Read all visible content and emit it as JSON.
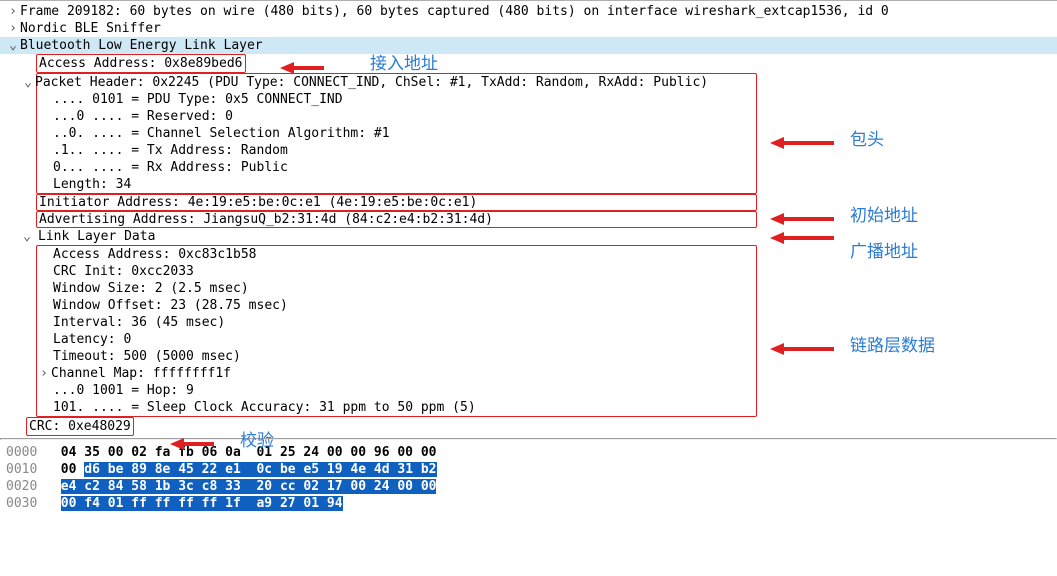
{
  "tree": {
    "frame": "Frame 209182: 60 bytes on wire (480 bits), 60 bytes captured (480 bits) on interface wireshark_extcap1536, id 0",
    "nordic": "Nordic BLE Sniffer",
    "ble_ll": "Bluetooth Low Energy Link Layer",
    "access_addr": "Access Address: 0x8e89bed6",
    "pkt_header": "Packet Header: 0x2245 (PDU Type: CONNECT_IND, ChSel: #1, TxAdd: Random, RxAdd: Public)",
    "pdu_type": ".... 0101 = PDU Type: 0x5 CONNECT_IND",
    "reserved": "...0 .... = Reserved: 0",
    "chsel": "..0. .... = Channel Selection Algorithm: #1",
    "txaddr": ".1.. .... = Tx Address: Random",
    "rxaddr": "0... .... = Rx Address: Public",
    "length": "Length: 34",
    "init_addr": "Initiator Address: 4e:19:e5:be:0c:e1 (4e:19:e5:be:0c:e1)",
    "adv_addr": "Advertising Address: JiangsuQ_b2:31:4d (84:c2:e4:b2:31:4d)",
    "lld": "Link Layer Data",
    "lld_access": "Access Address: 0xc83c1b58",
    "lld_crc": "CRC Init: 0xcc2033",
    "lld_win_size": "Window Size: 2 (2.5 msec)",
    "lld_win_off": "Window Offset: 23 (28.75 msec)",
    "lld_interval": "Interval: 36 (45 msec)",
    "lld_latency": "Latency: 0",
    "lld_timeout": "Timeout: 500 (5000 msec)",
    "lld_chmap": "Channel Map: ffffffff1f",
    "lld_hop": "...0 1001 = Hop: 9",
    "lld_sca": "101. .... = Sleep Clock Accuracy: 31 ppm to 50 ppm (5)",
    "crc": "CRC: 0xe48029"
  },
  "annotations": {
    "access": "接入地址",
    "header": "包头",
    "init": "初始地址",
    "adv": "广播地址",
    "lld": "链路层数据",
    "crc": "校验"
  },
  "hex": {
    "offsets": [
      "0000",
      "0010",
      "0020",
      "0030"
    ],
    "r0a": "04 35 00 02 fa fb 06 0a ",
    "r0b": " 01 25 24 00 00 96 00 00",
    "r1a": "00 ",
    "r1b": "d6 be 89 8e 45 22 e1 ",
    "r1c": " 0c be e5 19 4e 4d 31 b2",
    "r2a": "e4 c2 84 58 1b 3c c8 33 ",
    "r2b": " 20 cc 02 17 00 24 00 00",
    "r3a": "00 f4 01 ff ff ff ff 1f ",
    "r3b": " a9 27 01 94"
  }
}
